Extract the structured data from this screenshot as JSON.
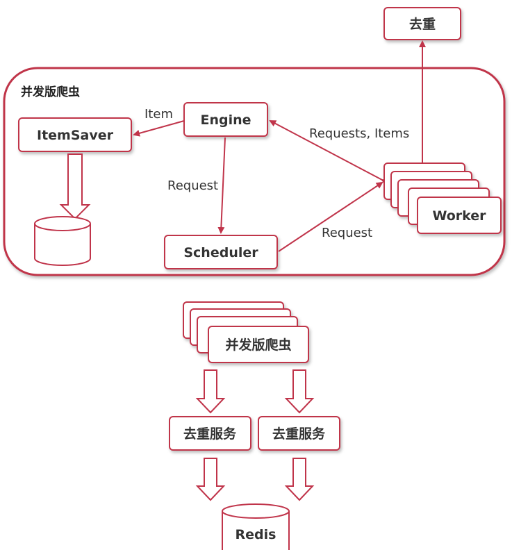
{
  "colors": {
    "accent": "#c0344a",
    "text": "#333333",
    "background": "#ffffff"
  },
  "nodes": {
    "dedup_top": "去重",
    "container_title": "并发版爬虫",
    "engine": "Engine",
    "itemsaver": "ItemSaver",
    "scheduler": "Scheduler",
    "worker": "Worker",
    "crawler_stack": "并发版爬虫",
    "dedup_service_1": "去重服务",
    "dedup_service_2": "去重服务",
    "redis": "Redis"
  },
  "edges": {
    "item": "Item",
    "request_down": "Request",
    "requests_items": "Requests, Items",
    "request_right": "Request"
  }
}
